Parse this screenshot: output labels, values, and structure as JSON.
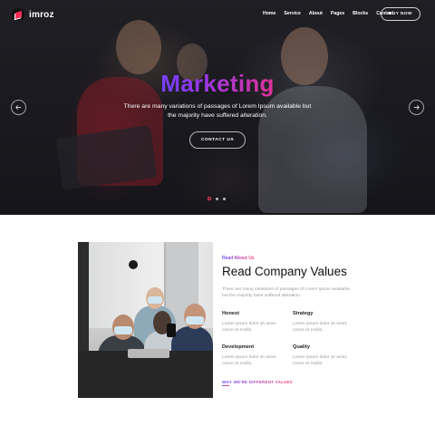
{
  "brand": {
    "name": "imroz"
  },
  "nav": {
    "items": [
      "Home",
      "Service",
      "About",
      "Pages",
      "Blocks",
      "Contact"
    ],
    "cta_label": "BUY NOW"
  },
  "hero": {
    "title": "Marketing",
    "subtitle": "There are many variations of passages of Lorem Ipsum available but the majority have suffered alteration.",
    "button_label": "CONTACT US",
    "slides_total": 3,
    "active_slide": 1
  },
  "about": {
    "eyebrow": "Read About Us",
    "title": "Read Company Values",
    "text": "There are many variations of passages of Lorem Ipsum available, but the majority have suffered alteration.",
    "values": [
      {
        "title": "Honest",
        "text": "Lorem ipsum dolor sit amet, cnsce et mollis."
      },
      {
        "title": "Strategy",
        "text": "Lorem ipsum dolor sit amet, cnsce et mollis."
      },
      {
        "title": "Development",
        "text": "Lorem ipsum dolor sit amet, cnsce et mollis."
      },
      {
        "title": "Quality",
        "text": "Lorem ipsum dolor sit amet, cnsce et mollis."
      }
    ],
    "link_label": "WHY WE'RE DIFFERENT VALUES"
  },
  "colors": {
    "accent_start": "#3b82ff",
    "accent_mid": "#7c3cff",
    "accent_end": "#ff3b5c"
  },
  "icons": {
    "logo": "imroz-logo-icon",
    "prev": "arrow-left-icon",
    "next": "arrow-right-icon"
  }
}
